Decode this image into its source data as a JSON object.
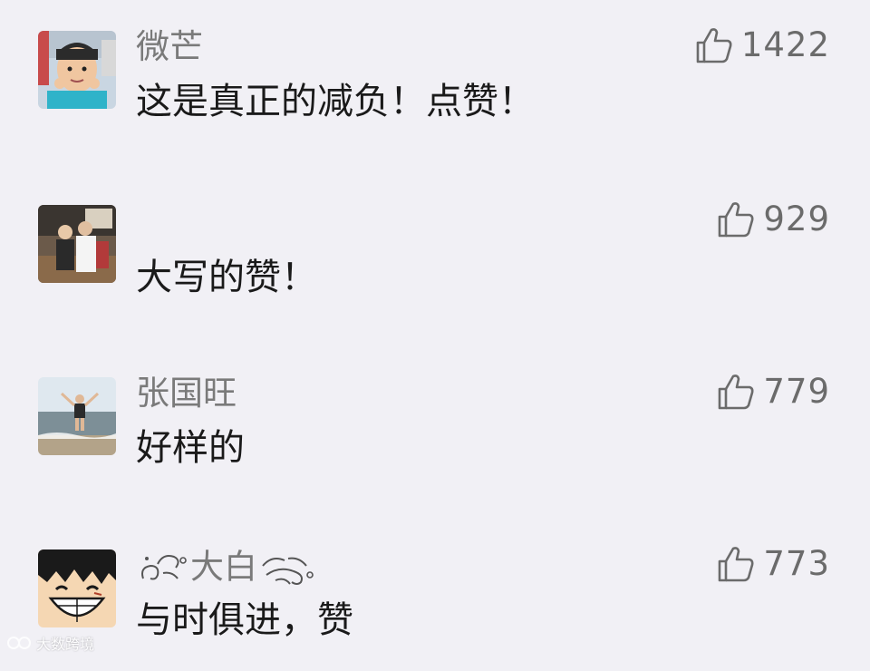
{
  "colors": {
    "background": "#f1f0f5",
    "nickname": "#7a7a7a",
    "comment_text": "#1a1a1a",
    "like": "#6b6b6b"
  },
  "comments": [
    {
      "nickname": "微芒",
      "text": "这是真正的减负！点赞！",
      "likes": "1422",
      "avatar_icon": "child-photo-avatar"
    },
    {
      "nickname": "",
      "text": "大写的赞！",
      "likes": "929",
      "avatar_icon": "people-photo-avatar"
    },
    {
      "nickname": "张国旺",
      "text": "好样的",
      "likes": "779",
      "avatar_icon": "beach-photo-avatar"
    },
    {
      "nickname": "大白",
      "text": "与时俱进，赞",
      "likes": "773",
      "avatar_icon": "cartoon-face-avatar"
    }
  ],
  "like_icon": "thumbs-up-icon",
  "watermark": {
    "text": "大数跨境"
  }
}
